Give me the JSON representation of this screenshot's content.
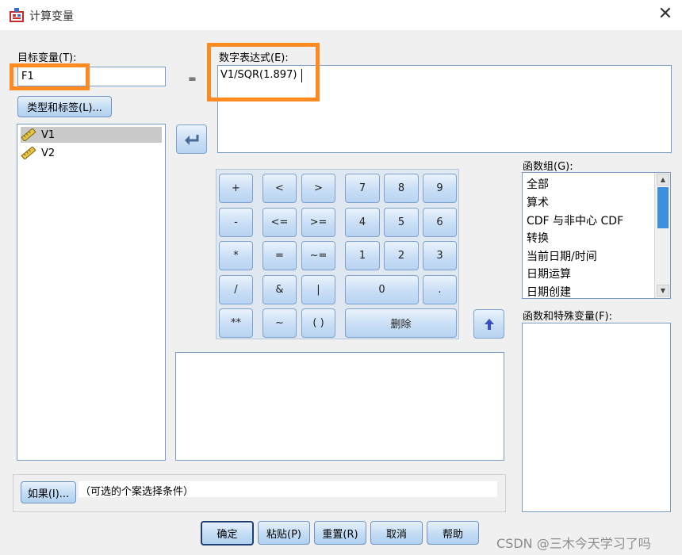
{
  "window": {
    "title": "计算变量"
  },
  "target": {
    "label": "目标变量(T):",
    "value": "F1",
    "type_label_button": "类型和标签(L)..."
  },
  "equals_sign": "=",
  "expression": {
    "label": "数字表达式(E):",
    "value": "V1/SQR(1.897)"
  },
  "variables": [
    {
      "name": "V1",
      "icon": "ruler-icon",
      "selected": true
    },
    {
      "name": "V2",
      "icon": "ruler-icon",
      "selected": false
    }
  ],
  "keypad": {
    "ops": [
      "+",
      "<",
      ">",
      "-",
      "<=",
      ">=",
      "*",
      "=",
      "~=",
      "/",
      "&",
      "|",
      "**",
      "~",
      "( )"
    ],
    "digits": [
      "7",
      "8",
      "9",
      "4",
      "5",
      "6",
      "1",
      "2",
      "3",
      "0",
      "."
    ],
    "delete": "删除"
  },
  "function_group": {
    "label": "函数组(G):",
    "items": [
      "全部",
      "算术",
      "CDF 与非中心 CDF",
      "转换",
      "当前日期/时间",
      "日期运算",
      "日期创建"
    ]
  },
  "functions": {
    "label": "函数和特殊变量(F):"
  },
  "if_condition": {
    "button": "如果(I)...",
    "text": "（可选的个案选择条件）"
  },
  "footer_buttons": {
    "ok": "确定",
    "paste": "粘贴(P)",
    "reset": "重置(R)",
    "cancel": "取消",
    "help": "帮助"
  },
  "watermark": "CSDN @三木今天学习了吗",
  "colors": {
    "highlight": "#ff8a1f",
    "button_border": "#6f94c4",
    "scroll_thumb": "#3d8fe0"
  }
}
